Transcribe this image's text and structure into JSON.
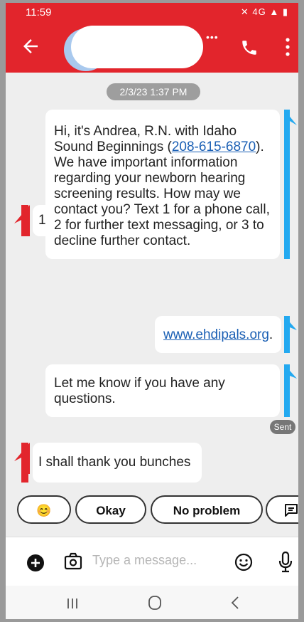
{
  "status": {
    "time": "11:59",
    "icons_text": "✕ 4G ▲ ▮"
  },
  "header": {
    "contact_name_redacted": ""
  },
  "conversation": {
    "date_pill": "2/3/23 1:37 PM",
    "messages": [
      {
        "direction": "outgoing",
        "text_before": "Hi, it's Andrea, R.N. with Idaho Sound Beginnings (",
        "link": "208-615-6870",
        "text_after": "). We have important information regarding your newborn hearing screening results. How may we contact you? Text 1 for a phone call, 2 for further text messaging, or 3 to decline further contact."
      },
      {
        "direction": "incoming",
        "text": "1"
      },
      {
        "direction": "outgoing",
        "link": "www.ehdipals.org",
        "text_after": "."
      },
      {
        "direction": "outgoing",
        "text": "Let me know if you have any questions."
      },
      {
        "direction": "incoming",
        "text": "I shall thank you bunches"
      }
    ],
    "sent_label": "Sent"
  },
  "quick_replies": [
    {
      "label": "😊"
    },
    {
      "label": "Okay"
    },
    {
      "label": "No problem"
    }
  ],
  "composer": {
    "placeholder": "Type a message..."
  },
  "colors": {
    "accent": "#e2252c",
    "outgoing_tail": "#23a9f0",
    "link": "#1a5fb4"
  },
  "icons": [
    "back-arrow-icon",
    "phone-icon",
    "more-vert-icon",
    "plus-circle-icon",
    "camera-icon",
    "emoji-icon",
    "mic-icon",
    "message-icon"
  ]
}
